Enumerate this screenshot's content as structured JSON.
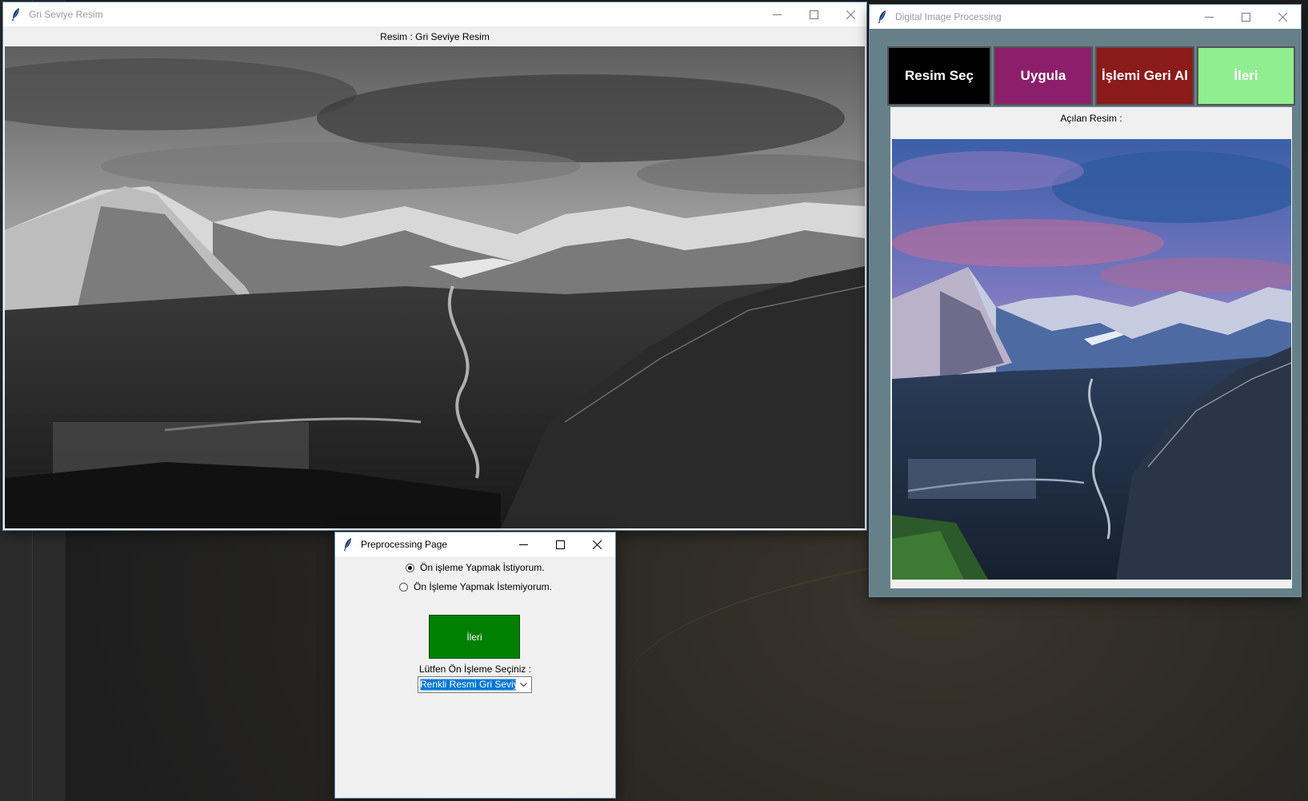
{
  "gray_window": {
    "title": "Gri Seviye Resim",
    "caption": "Resim : Gri Seviye Resim"
  },
  "dip_window": {
    "title": "Digital Image Processing",
    "buttons": {
      "select": "Resim Seç",
      "apply": "Uygula",
      "undo": "İşlemi Geri Al",
      "next": "İleri"
    },
    "button_colors": {
      "select": "#000000",
      "apply": "#8b1f6b",
      "undo": "#8b1a1a",
      "next": "#90ee90"
    },
    "caption": "Açılan Resim :"
  },
  "pre_window": {
    "title": "Preprocessing Page",
    "option_yes": "Ön işleme Yapmak İstiyorum.",
    "option_no": "Ön İşleme Yapmak İstemiyorum.",
    "selected_option": "option_yes",
    "next_label": "İleri",
    "next_color": "#008000",
    "select_label": "Lütfen Ön İşleme Seçiniz :",
    "combo_value": "Renkli Resmi Gri Seviye"
  },
  "icons": {
    "app": "feather-icon",
    "minimize": "minimize-icon",
    "maximize": "maximize-icon",
    "close": "close-icon",
    "dropdown": "chevron-down-icon"
  }
}
